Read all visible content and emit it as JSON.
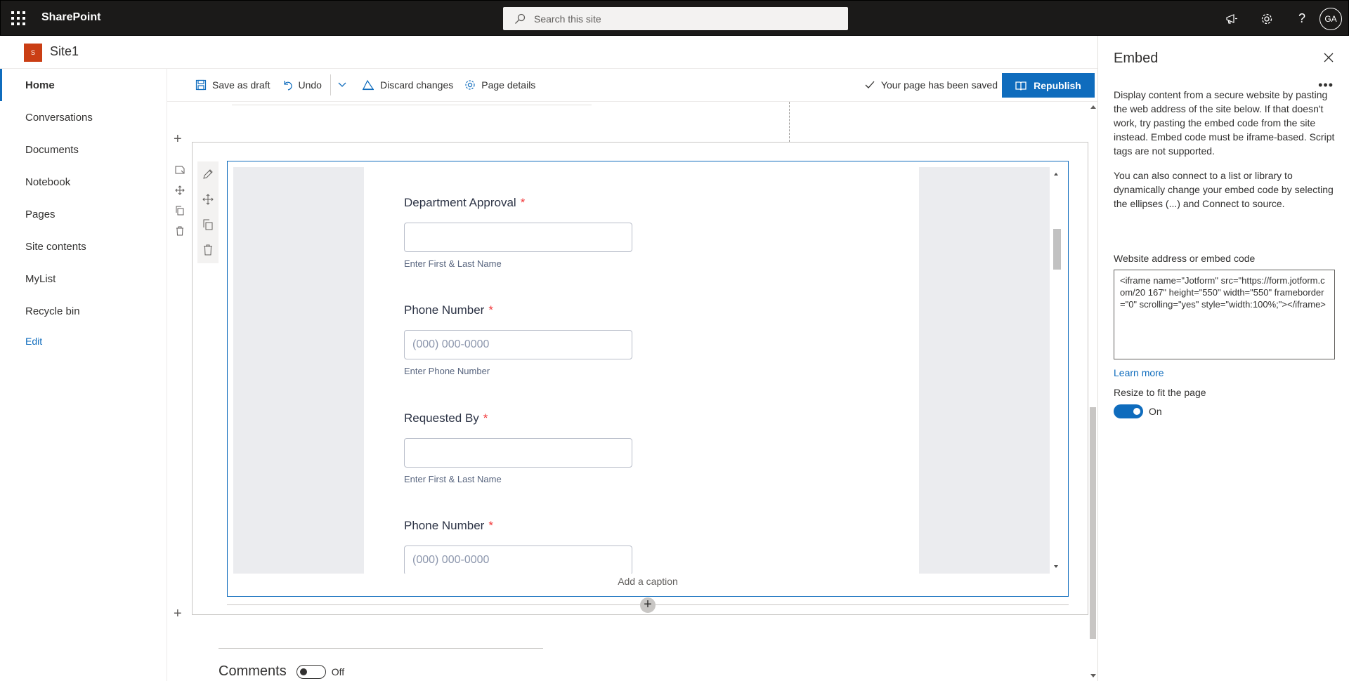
{
  "suite": {
    "brand": "SharePoint",
    "search_placeholder": "Search this site",
    "avatar_initials": "GA"
  },
  "site": {
    "logo_letter": "S",
    "title": "Site1"
  },
  "nav": {
    "items": [
      "Home",
      "Conversations",
      "Documents",
      "Notebook",
      "Pages",
      "Site contents",
      "MyList",
      "Recycle bin"
    ],
    "edit": "Edit"
  },
  "commandbar": {
    "save_draft": "Save as draft",
    "undo": "Undo",
    "discard": "Discard changes",
    "page_details": "Page details",
    "saved_status": "Your page has been saved",
    "republish": "Republish"
  },
  "form": {
    "fields": [
      {
        "label": "Department Approval",
        "required": "*",
        "value": "",
        "help": "Enter First & Last Name"
      },
      {
        "label": "Phone Number",
        "required": "*",
        "value": "(000) 000-0000",
        "help": "Enter Phone Number"
      },
      {
        "label": "Requested By",
        "required": "*",
        "value": "",
        "help": "Enter First & Last Name"
      },
      {
        "label": "Phone Number",
        "required": "*",
        "value": "(000) 000-0000",
        "help": ""
      }
    ],
    "caption": "Add a caption"
  },
  "comments": {
    "title": "Comments",
    "state": "Off"
  },
  "panel": {
    "title": "Embed",
    "desc1": "Display content from a secure website by pasting the web address of the site below. If that doesn't work, try pasting the embed code from the site instead. Embed code must be iframe-based. Script tags are not supported.",
    "desc2": "You can also connect to a list or library to dynamically change your embed code by selecting the ellipses (...) and Connect to source.",
    "field_label": "Website address or embed code",
    "embed_code": "<iframe name=\"Jotform\" src=\"https://form.jotform.com/20 167\" height=\"550\" width=\"550\" frameborder=\"0\" scrolling=\"yes\" style=\"width:100%;\"></iframe>",
    "learn_more": "Learn more",
    "resize_label": "Resize to fit the page",
    "resize_state": "On"
  }
}
